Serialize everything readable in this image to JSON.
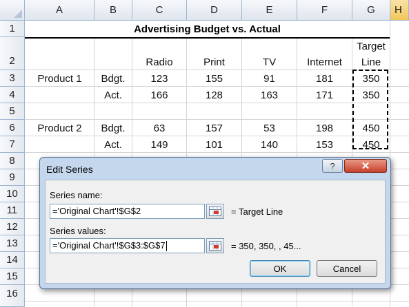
{
  "columns": [
    "A",
    "B",
    "C",
    "D",
    "E",
    "F",
    "G",
    "H"
  ],
  "rows": [
    "1",
    "2",
    "3",
    "4",
    "5",
    "6",
    "7",
    "8",
    "9",
    "10",
    "11",
    "12",
    "13",
    "14",
    "15",
    "16"
  ],
  "sheet": {
    "title": "Advertising Budget vs. Actual",
    "headers": {
      "radio": "Radio",
      "print": "Print",
      "tv": "TV",
      "internet": "Internet",
      "target1": "Target",
      "target2": "Line"
    },
    "rows": [
      {
        "product": "Product 1",
        "kind": "Bdgt.",
        "radio": "123",
        "print": "155",
        "tv": "91",
        "internet": "181",
        "target": "350"
      },
      {
        "product": "",
        "kind": "Act.",
        "radio": "166",
        "print": "128",
        "tv": "163",
        "internet": "171",
        "target": "350"
      },
      {
        "product": "Product 2",
        "kind": "Bdgt.",
        "radio": "63",
        "print": "157",
        "tv": "53",
        "internet": "198",
        "target": "450"
      },
      {
        "product": "",
        "kind": "Act.",
        "radio": "149",
        "print": "101",
        "tv": "140",
        "internet": "153",
        "target": "450"
      }
    ]
  },
  "dialog": {
    "title": "Edit Series",
    "help_label": "?",
    "close_label": "✕",
    "series_name_label": "Series name:",
    "series_name_value": "='Original Chart'!$G$2",
    "series_name_preview": "= Target Line",
    "series_values_label": "Series values:",
    "series_values_value": "='Original Chart'!$G$3:$G$7",
    "series_values_preview": "= 350, 350, , 45...",
    "ok_label": "OK",
    "cancel_label": "Cancel"
  },
  "colors": {
    "header_bg": "#dfe5ee",
    "selected_header": "#f3c759",
    "dialog_frame": "#c4d7ec",
    "close_button": "#c7402b"
  }
}
